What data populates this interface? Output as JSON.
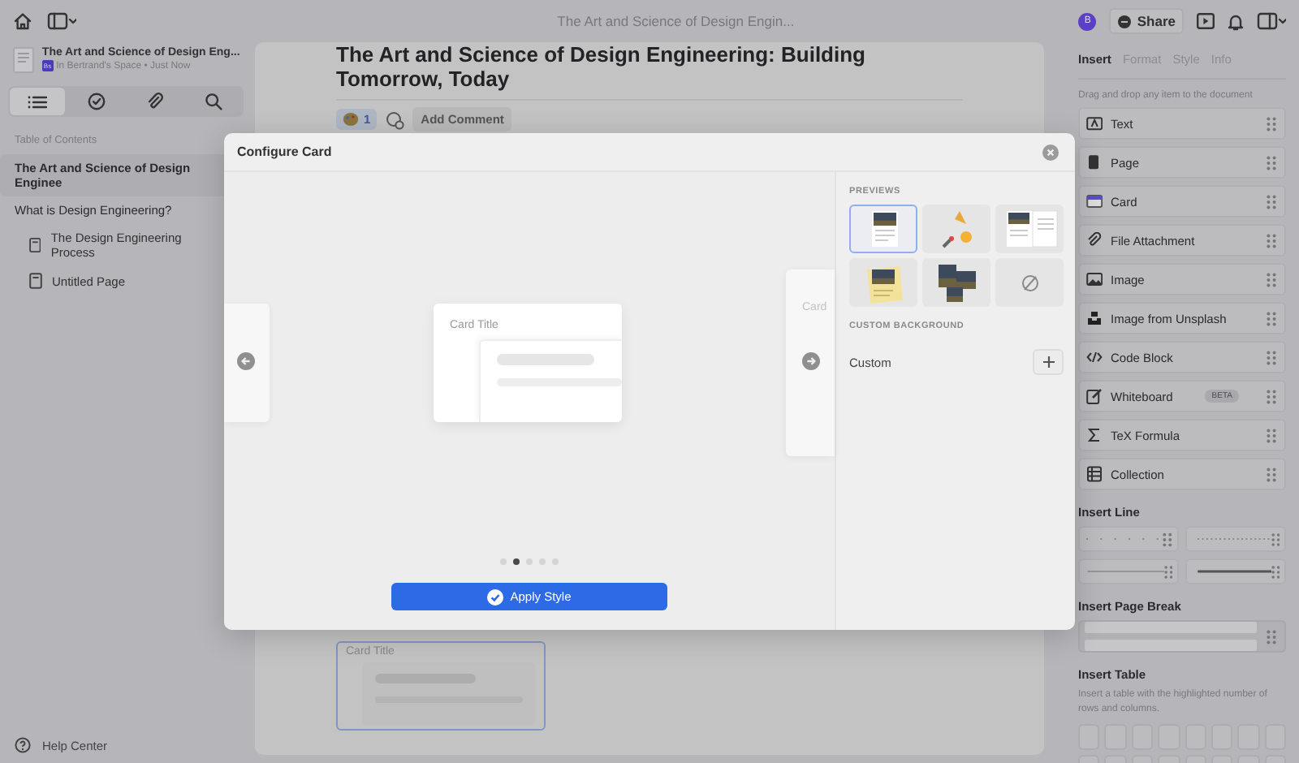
{
  "topbar": {
    "title": "The Art and Science of Design Engin...",
    "avatar": "B",
    "share": "Share"
  },
  "sidebar": {
    "doc_title": "The Art and Science of Design Eng...",
    "space_badge": "Bs",
    "doc_meta": "In Bertrand's Space • Just Now",
    "tabs": [
      {
        "kind": "list",
        "selected": true
      },
      {
        "kind": "check",
        "selected": false
      },
      {
        "kind": "clip",
        "selected": false
      },
      {
        "kind": "search",
        "selected": false
      }
    ],
    "toc_heading": "Table of Contents",
    "toc": [
      {
        "label": "The Art and Science of Design Enginee",
        "kind": "heading",
        "selected": true
      },
      {
        "label": "What is Design Engineering?",
        "kind": "heading",
        "selected": false,
        "children": [
          {
            "label": "The Design Engineering Process",
            "kind": "page",
            "selected": false
          },
          {
            "label": "Untitled Page",
            "kind": "page",
            "selected": false
          }
        ]
      }
    ],
    "help": "Help Center"
  },
  "document": {
    "title": "The Art and Science of Design Engineering: Building Tomorrow, Today",
    "reaction_count": "1",
    "add_comment": "Add Comment",
    "card_title": "Card Title"
  },
  "inspector": {
    "tabs": [
      {
        "label": "Insert",
        "selected": true
      },
      {
        "label": "Format",
        "selected": false
      },
      {
        "label": "Style",
        "selected": false
      },
      {
        "label": "Info",
        "selected": false
      }
    ],
    "hint": "Drag and drop any item to the document",
    "items": [
      {
        "label": "Text",
        "kind": "text"
      },
      {
        "label": "Page",
        "kind": "page"
      },
      {
        "label": "Card",
        "kind": "card"
      },
      {
        "label": "File Attachment",
        "kind": "file"
      },
      {
        "label": "Image",
        "kind": "image"
      },
      {
        "label": "Image from Unsplash",
        "kind": "unsplash"
      },
      {
        "label": "Code Block",
        "kind": "code"
      },
      {
        "label": "Whiteboard",
        "kind": "whiteboard",
        "badge": "BETA"
      },
      {
        "label": "TeX Formula",
        "kind": "tex"
      },
      {
        "label": "Collection",
        "kind": "collection"
      }
    ],
    "line_heading": "Insert Line",
    "lines": [
      {
        "kind": "sparse-dots"
      },
      {
        "kind": "dots"
      },
      {
        "kind": "thin"
      },
      {
        "kind": "thick"
      }
    ],
    "page_break_heading": "Insert Page Break",
    "table_heading": "Insert Table",
    "table_hint": "Insert a table with the highlighted number of rows and columns."
  },
  "dialog": {
    "title": "Configure Card",
    "side_card_title": "Card",
    "card_title": "Card Title",
    "dots": [
      {
        "selected": false
      },
      {
        "selected": true
      },
      {
        "selected": false
      },
      {
        "selected": false
      },
      {
        "selected": false
      }
    ],
    "apply": "Apply Style",
    "previews_heading": "PREVIEWS",
    "previews": [
      {
        "kind": "page",
        "selected": true
      },
      {
        "kind": "emoji",
        "selected": false
      },
      {
        "kind": "spread",
        "selected": false
      },
      {
        "kind": "note",
        "selected": false
      },
      {
        "kind": "photos",
        "selected": false
      },
      {
        "kind": "none",
        "selected": false
      }
    ],
    "custom_heading": "CUSTOM BACKGROUND",
    "custom_label": "Custom"
  }
}
